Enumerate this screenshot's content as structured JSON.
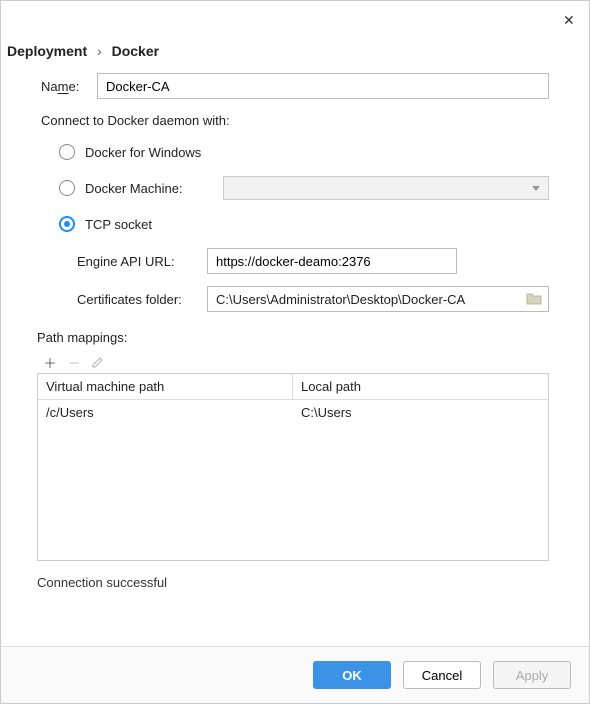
{
  "breadcrumb": {
    "parent": "Deployment",
    "current": "Docker",
    "sep": "›"
  },
  "fields": {
    "name_label": "Name:",
    "name_value": "Docker-CA",
    "connect_label": "Connect to Docker daemon with:",
    "radio_windows": "Docker for Windows",
    "radio_machine": "Docker Machine:",
    "radio_tcp": "TCP socket",
    "engine_url_label": "Engine API URL:",
    "engine_url_value": "https://docker-deamo:2376",
    "cert_folder_label": "Certificates folder:",
    "cert_folder_value": "C:\\Users\\Administrator\\Desktop\\Docker-CA",
    "path_mappings_label": "Path mappings:"
  },
  "table": {
    "col_vm": "Virtual machine path",
    "col_local": "Local path",
    "rows": [
      {
        "vm": "/c/Users",
        "local": "C:\\Users"
      }
    ]
  },
  "status": "Connection successful",
  "buttons": {
    "ok": "OK",
    "cancel": "Cancel",
    "apply": "Apply"
  }
}
